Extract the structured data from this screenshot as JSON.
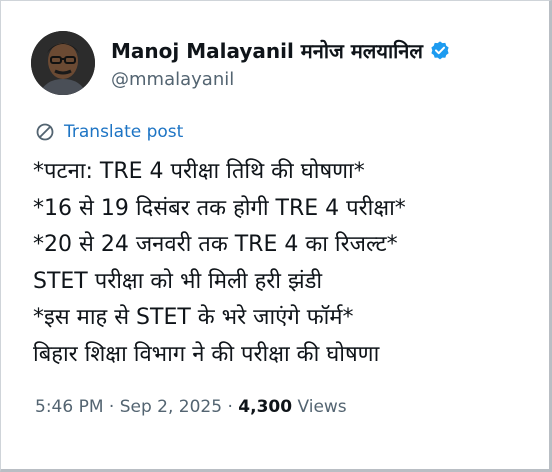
{
  "author": {
    "display_name": "Manoj Malayanil मनोज मलयानिल",
    "handle": "@mmalayanil",
    "verified_icon": "verified-badge-icon",
    "avatar_icon": "avatar-photo"
  },
  "translate_label": "Translate post",
  "post_lines": [
    "*पटना: TRE 4 परीक्षा तिथि की घोषणा*",
    "*16 से 19 दिसंबर तक होगी TRE 4 परीक्षा*",
    "*20 से 24 जनवरी तक TRE 4 का रिजल्ट*",
    "STET परीक्षा को भी मिली हरी झंडी",
    "*इस माह से STET के भरे जाएंगे फॉर्म*",
    "बिहार शिक्षा विभाग ने की परीक्षा की घोषणा"
  ],
  "meta": {
    "time": "5:46 PM",
    "separator": " · ",
    "date": "Sep 2, 2025",
    "views_count": "4,300",
    "views_label": " Views"
  },
  "colors": {
    "link_blue": "#1d74c4",
    "verified_blue": "#1d9bf0",
    "secondary_text": "#536471"
  }
}
